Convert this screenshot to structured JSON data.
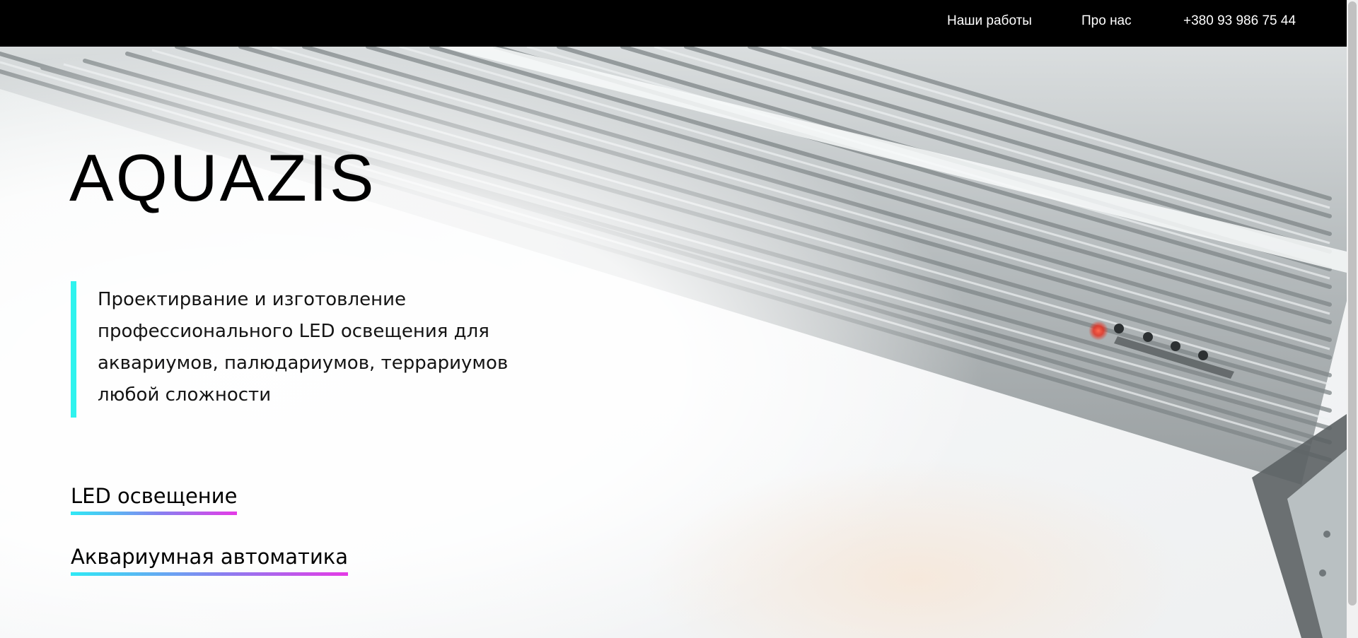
{
  "nav": {
    "works": "Наши работы",
    "about": "Про нас",
    "phone": "+380 93 986 75 44"
  },
  "hero": {
    "brand": "AQUAZIS",
    "tagline": "Проектирвание и изготовление профессионального LED освещения для аквариумов, палюдариумов, террариумов любой сложности",
    "categories": [
      {
        "label": "LED освещение"
      },
      {
        "label": "Аквариумная автоматика"
      }
    ]
  },
  "colors": {
    "topbar": "#000000",
    "accent_bar": "#2ff3ee",
    "underline_start": "#2ee9f5",
    "underline_end": "#e53ae6"
  },
  "icons": {
    "hero_image": "led-aquarium-lamp-photo"
  }
}
